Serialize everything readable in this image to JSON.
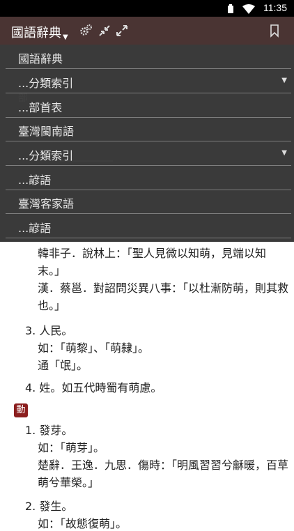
{
  "status_bar": {
    "time": "11:35"
  },
  "toolbar": {
    "title": "國語辭典",
    "icons": [
      "settings-icon",
      "collapse-icon",
      "expand-icon",
      "bookmark-icon"
    ]
  },
  "dropdown_menu": {
    "items": [
      {
        "label": "國語辭典",
        "has_dropdown": false
      },
      {
        "label": "...分類索引",
        "has_dropdown": true
      },
      {
        "label": "...部首表",
        "has_dropdown": false
      },
      {
        "label": "臺灣閩南語",
        "has_dropdown": false
      },
      {
        "label": "...分類索引",
        "has_dropdown": true
      },
      {
        "label": "...諺語",
        "has_dropdown": false
      },
      {
        "label": "臺灣客家語",
        "has_dropdown": false
      },
      {
        "label": "...諺語",
        "has_dropdown": false
      }
    ]
  },
  "article": {
    "lines": [
      "韓非子．說林上：「聖人見微以知萌，見端以知",
      "末。」",
      "漢．蔡邕．對詔問災異八事：「以杜漸防萌，則其救",
      "也。」",
      "3. 人民。",
      "如：「萌黎」、「萌隸」。",
      "通「氓」。",
      "4. 姓。如五代時蜀有萌慮。",
      "動",
      "1. 發芽。",
      "如：「萌芽」。",
      "楚辭．王逸．九思．傷時：「明風習習兮龢暖，百草",
      "萌兮華榮。」",
      "2. 發生。",
      "如：「故態復萌」。"
    ]
  }
}
